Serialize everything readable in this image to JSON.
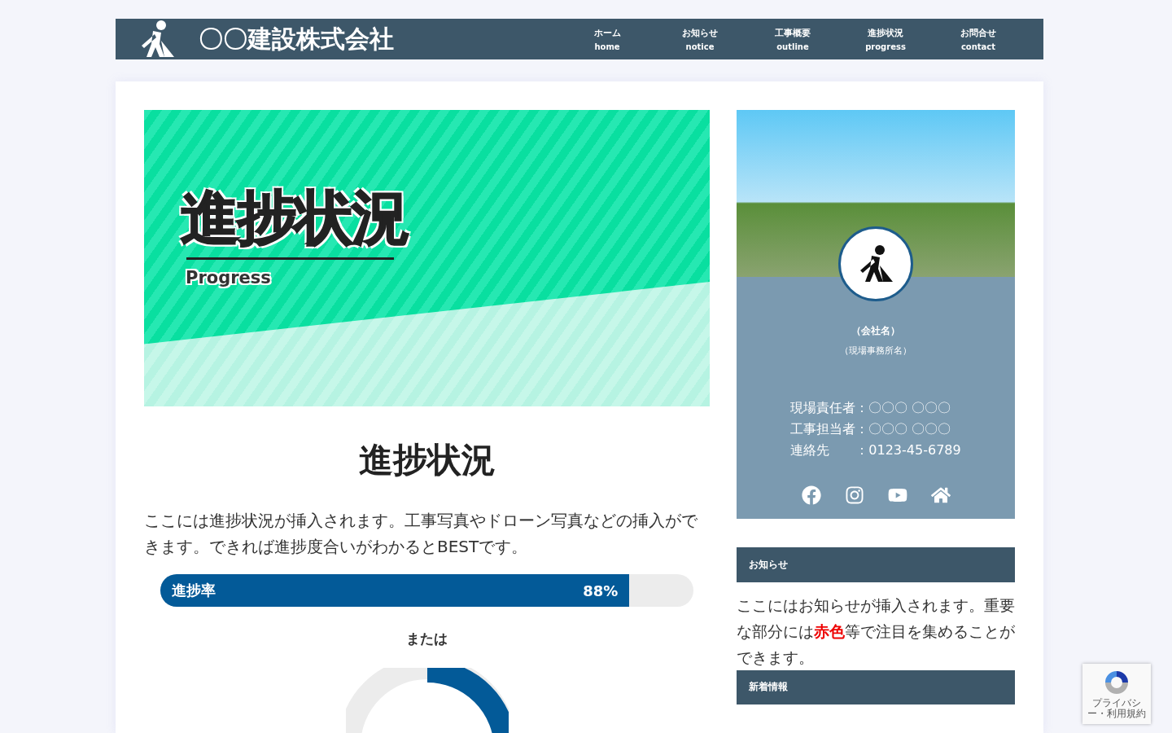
{
  "header": {
    "site_title": "〇〇建設株式会社",
    "nav": [
      {
        "label": "ホーム",
        "sub": "home"
      },
      {
        "label": "お知らせ",
        "sub": "notice"
      },
      {
        "label": "工事概要",
        "sub": "outline"
      },
      {
        "label": "進捗状況",
        "sub": "progress"
      },
      {
        "label": "お問合せ",
        "sub": "contact"
      }
    ]
  },
  "hero": {
    "title": "進捗状況",
    "subtitle": "Progress"
  },
  "main": {
    "heading": "進捗状況",
    "body": "ここには進捗状況が挿入されます。工事写真やドローン写真などの挿入ができます。できれば進捗度合いがわかるとBESTです。",
    "progress": {
      "label": "進捗率",
      "reading": "88%",
      "level": 0.88
    },
    "separator": "または"
  },
  "profile": {
    "company": "（会社名）",
    "office": "（現場事務所名）",
    "contacts": [
      {
        "label": "現場責任者",
        "value": "：〇〇〇 〇〇〇"
      },
      {
        "label": "工事担当者",
        "value": "：〇〇〇 〇〇〇"
      },
      {
        "label": "連絡先",
        "value": "：0123-45-6789"
      }
    ],
    "social": [
      {
        "kind": "facebook"
      },
      {
        "kind": "instagram"
      },
      {
        "kind": "youtube"
      },
      {
        "kind": "home"
      }
    ]
  },
  "notice": {
    "title": "お知らせ",
    "body": "ここにはお知らせが挿入されます。重要な部分には**赤色**等で注目を集めることができます。"
  },
  "news": {
    "title": "新着情報"
  },
  "recaptcha": {
    "links": "プライバシー・利用規約"
  }
}
